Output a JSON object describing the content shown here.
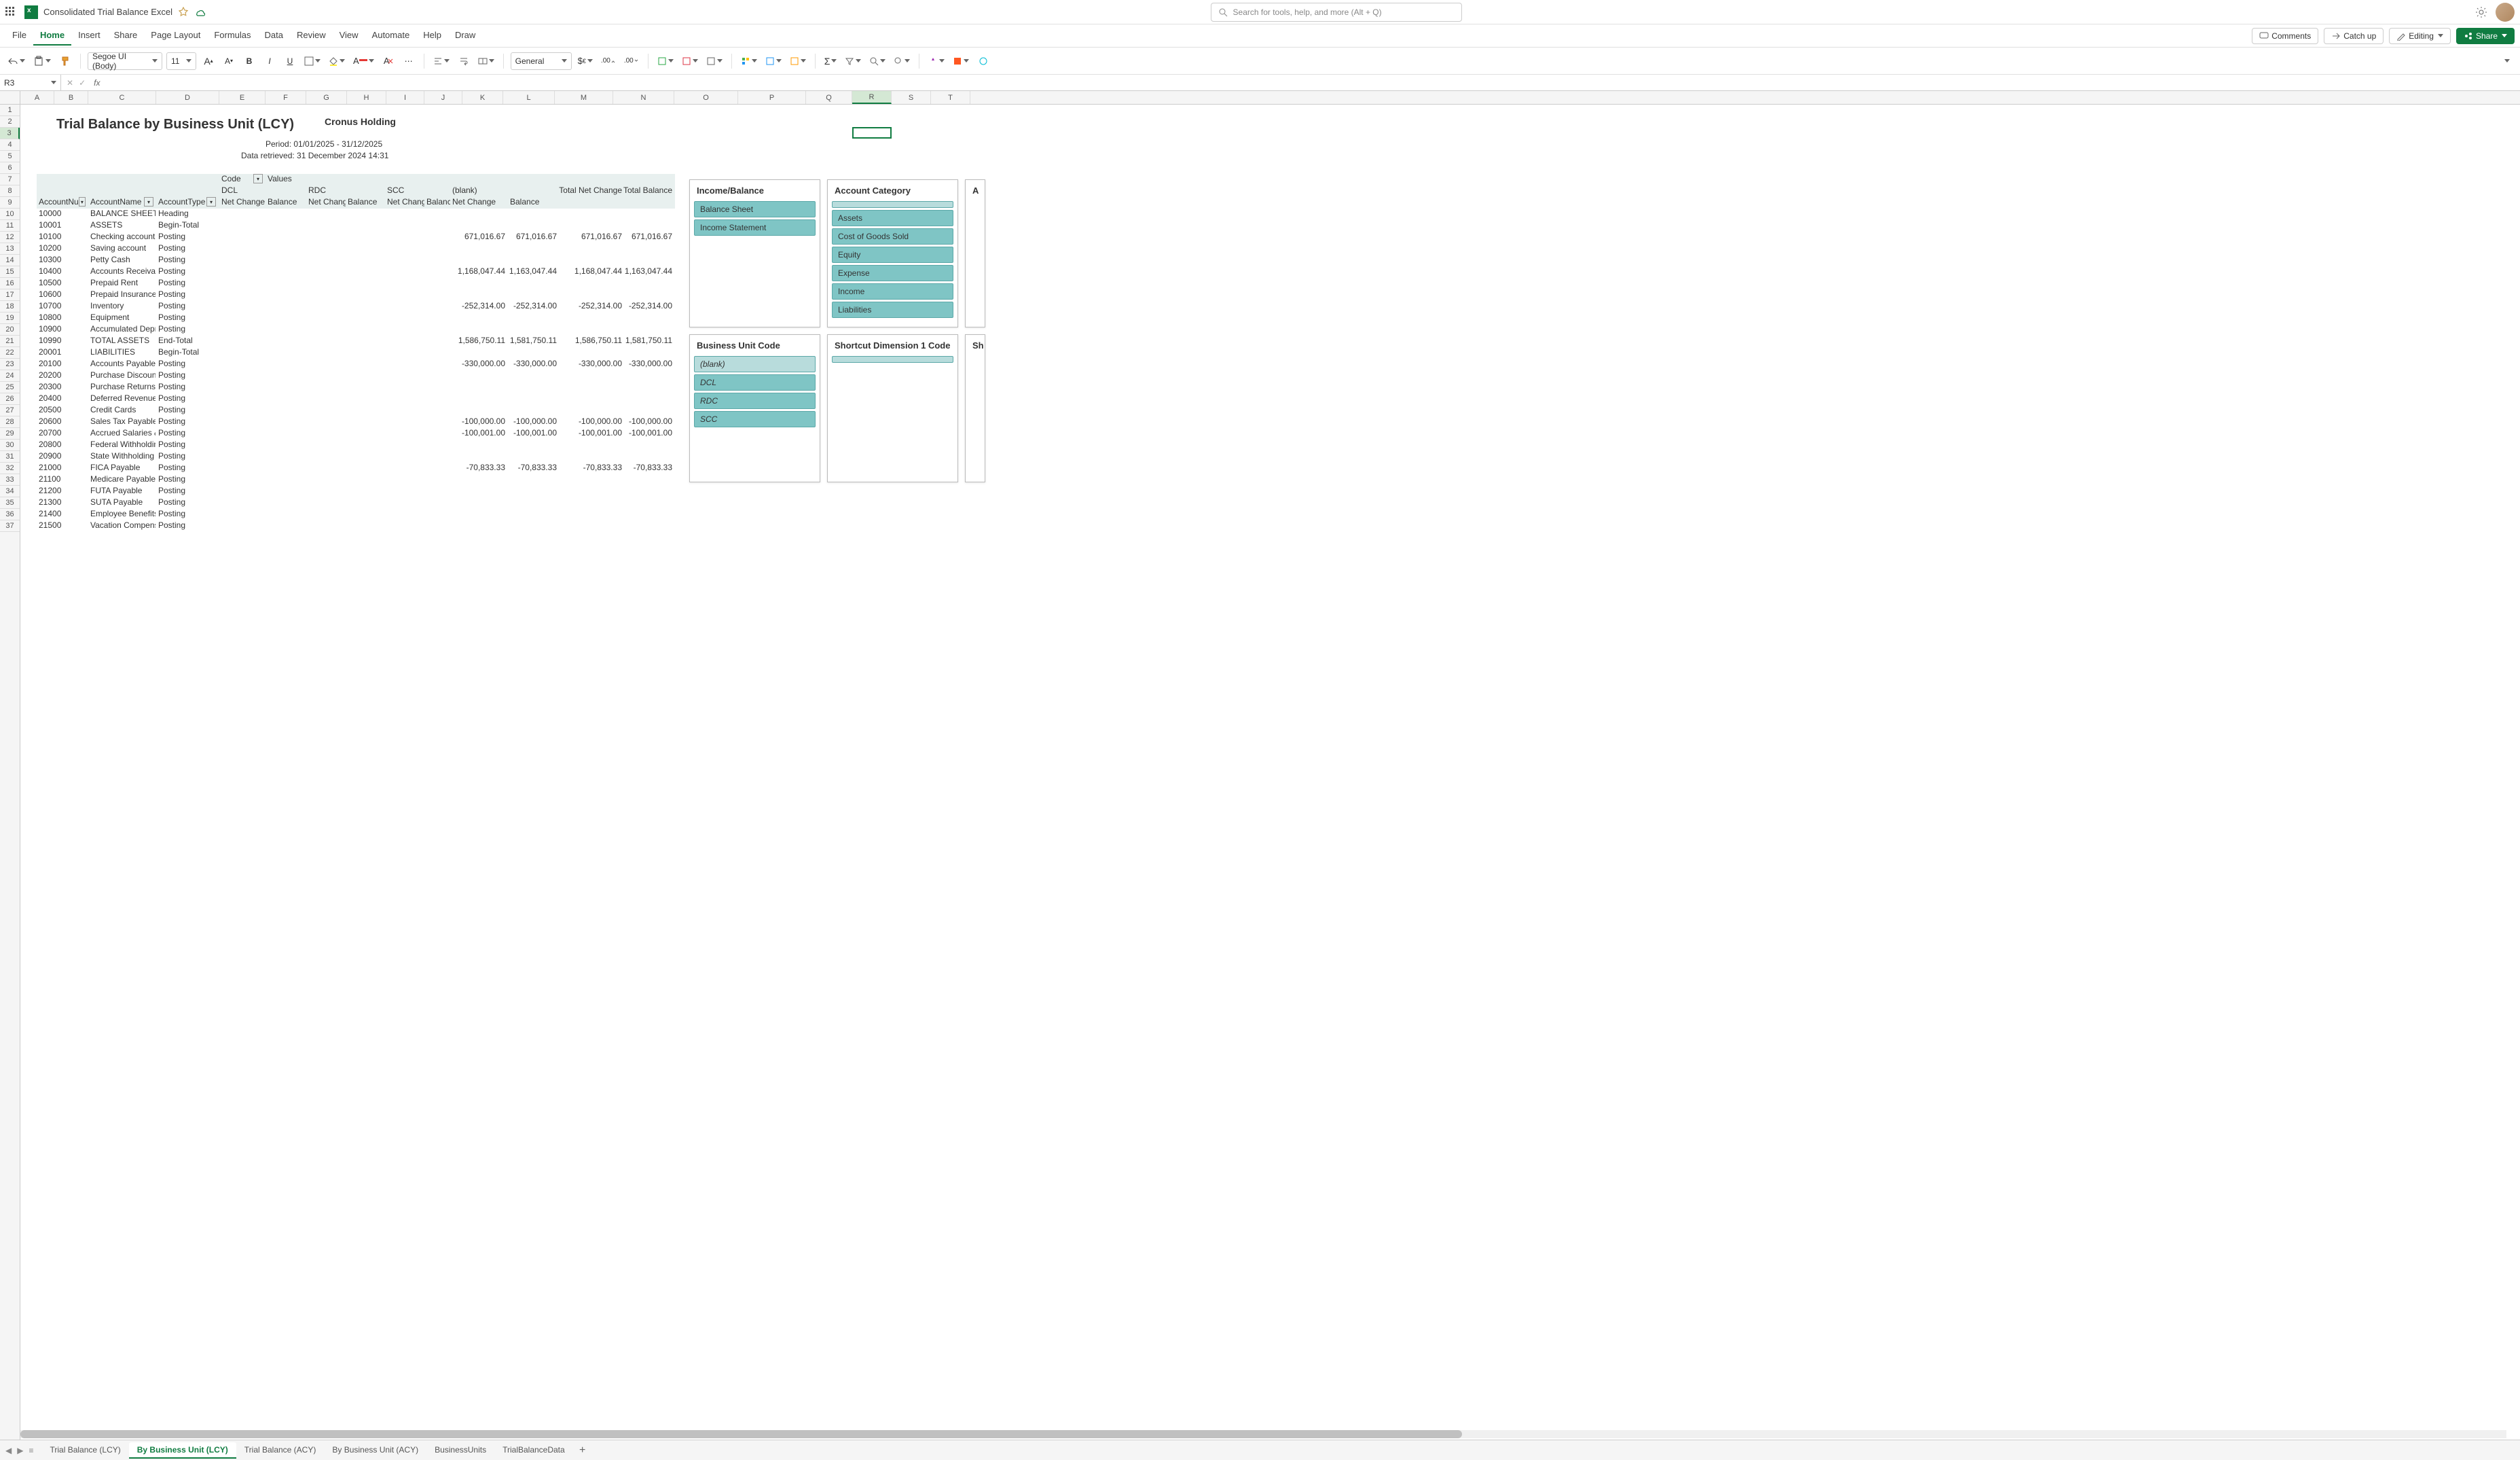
{
  "doc_title": "Consolidated Trial Balance Excel",
  "search_placeholder": "Search for tools, help, and more (Alt + Q)",
  "menu": [
    "File",
    "Home",
    "Insert",
    "Share",
    "Page Layout",
    "Formulas",
    "Data",
    "Review",
    "View",
    "Automate",
    "Help",
    "Draw"
  ],
  "menu_active": "Home",
  "menubar_right": {
    "comments": "Comments",
    "catchup": "Catch up",
    "editing": "Editing",
    "share": "Share"
  },
  "toolbar": {
    "font": "Segoe UI (Body)",
    "size": "11",
    "format": "General"
  },
  "namebox": "R3",
  "columns": [
    {
      "l": "A",
      "w": 50
    },
    {
      "l": "B",
      "w": 50
    },
    {
      "l": "C",
      "w": 100
    },
    {
      "l": "D",
      "w": 93
    },
    {
      "l": "E",
      "w": 68
    },
    {
      "l": "F",
      "w": 60
    },
    {
      "l": "G",
      "w": 60
    },
    {
      "l": "H",
      "w": 58
    },
    {
      "l": "I",
      "w": 56
    },
    {
      "l": "J",
      "w": 56
    },
    {
      "l": "K",
      "w": 60
    },
    {
      "l": "L",
      "w": 76
    },
    {
      "l": "M",
      "w": 86
    },
    {
      "l": "N",
      "w": 90
    },
    {
      "l": "O",
      "w": 94
    },
    {
      "l": "P",
      "w": 100
    },
    {
      "l": "Q",
      "w": 68
    },
    {
      "l": "R",
      "w": 58
    },
    {
      "l": "S",
      "w": 58
    },
    {
      "l": "T",
      "w": 58
    }
  ],
  "report": {
    "title": "Trial Balance by Business Unit (LCY)",
    "company": "Cronus Holding",
    "period": "Period: 01/01/2025 - 31/12/2025",
    "retrieved": "Data retrieved: 31 December 2024 14:31"
  },
  "pivotcols": {
    "code_label": "Code",
    "values_label": "Values",
    "groups": [
      "DCL",
      "RDC",
      "SCC",
      "(blank)"
    ],
    "subcols": [
      "Net Change",
      "Balance"
    ],
    "rowhdrs": [
      "AccountNu",
      "AccountName",
      "AccountType"
    ],
    "totals": [
      "Total Net Change",
      "Total Balance"
    ]
  },
  "rows": [
    {
      "n": "10000",
      "name": "BALANCE SHEET",
      "type": "Heading"
    },
    {
      "n": "10001",
      "name": "ASSETS",
      "type": "Begin-Total"
    },
    {
      "n": "10100",
      "name": "Checking account",
      "type": "Posting",
      "knc": "671,016.67",
      "kbal": "671,016.67",
      "tnc": "671,016.67",
      "tbal": "671,016.67"
    },
    {
      "n": "10200",
      "name": "Saving account",
      "type": "Posting"
    },
    {
      "n": "10300",
      "name": "Petty Cash",
      "type": "Posting"
    },
    {
      "n": "10400",
      "name": "Accounts Receivabl",
      "type": "Posting",
      "knc": "1,168,047.44",
      "kbal": "1,163,047.44",
      "tnc": "1,168,047.44",
      "tbal": "1,163,047.44"
    },
    {
      "n": "10500",
      "name": "Prepaid Rent",
      "type": "Posting"
    },
    {
      "n": "10600",
      "name": "Prepaid Insurance",
      "type": "Posting"
    },
    {
      "n": "10700",
      "name": "Inventory",
      "type": "Posting",
      "knc": "-252,314.00",
      "kbal": "-252,314.00",
      "tnc": "-252,314.00",
      "tbal": "-252,314.00"
    },
    {
      "n": "10800",
      "name": "Equipment",
      "type": "Posting"
    },
    {
      "n": "10900",
      "name": "Accumulated Depre",
      "type": "Posting"
    },
    {
      "n": "10990",
      "name": "TOTAL ASSETS",
      "type": "End-Total",
      "knc": "1,586,750.11",
      "kbal": "1,581,750.11",
      "tnc": "1,586,750.11",
      "tbal": "1,581,750.11"
    },
    {
      "n": "20001",
      "name": "LIABILITIES",
      "type": "Begin-Total"
    },
    {
      "n": "20100",
      "name": "Accounts Payable",
      "type": "Posting",
      "knc": "-330,000.00",
      "kbal": "-330,000.00",
      "tnc": "-330,000.00",
      "tbal": "-330,000.00"
    },
    {
      "n": "20200",
      "name": "Purchase Discounts",
      "type": "Posting"
    },
    {
      "n": "20300",
      "name": "Purchase Returns &",
      "type": "Posting"
    },
    {
      "n": "20400",
      "name": "Deferred Revenue",
      "type": "Posting"
    },
    {
      "n": "20500",
      "name": "Credit Cards",
      "type": "Posting"
    },
    {
      "n": "20600",
      "name": "Sales Tax Payable",
      "type": "Posting",
      "knc": "-100,000.00",
      "kbal": "-100,000.00",
      "tnc": "-100,000.00",
      "tbal": "-100,000.00"
    },
    {
      "n": "20700",
      "name": "Accrued Salaries &",
      "type": "Posting",
      "knc": "-100,001.00",
      "kbal": "-100,001.00",
      "tnc": "-100,001.00",
      "tbal": "-100,001.00"
    },
    {
      "n": "20800",
      "name": "Federal Withholdin",
      "type": "Posting"
    },
    {
      "n": "20900",
      "name": "State Withholding F",
      "type": "Posting"
    },
    {
      "n": "21000",
      "name": "FICA Payable",
      "type": "Posting",
      "knc": "-70,833.33",
      "kbal": "-70,833.33",
      "tnc": "-70,833.33",
      "tbal": "-70,833.33"
    },
    {
      "n": "21100",
      "name": "Medicare Payable",
      "type": "Posting"
    },
    {
      "n": "21200",
      "name": "FUTA Payable",
      "type": "Posting"
    },
    {
      "n": "21300",
      "name": "SUTA Payable",
      "type": "Posting"
    },
    {
      "n": "21400",
      "name": "Employee Benefits F",
      "type": "Posting"
    },
    {
      "n": "21500",
      "name": "Vacation Compensa",
      "type": "Posting"
    }
  ],
  "slicers": {
    "income_balance": {
      "title": "Income/Balance",
      "items": [
        "Balance Sheet",
        "Income Statement"
      ]
    },
    "account_category": {
      "title": "Account Category",
      "items": [
        "",
        "Assets",
        "Cost of Goods Sold",
        "Equity",
        "Expense",
        "Income",
        "Liabilities"
      ]
    },
    "business_unit": {
      "title": "Business Unit Code",
      "items": [
        "(blank)",
        "DCL",
        "RDC",
        "SCC"
      ]
    },
    "dimension1": {
      "title": "Shortcut Dimension 1 Code",
      "items": [
        ""
      ]
    },
    "partial1": {
      "title": "A"
    },
    "partial2": {
      "title": "Sh"
    }
  },
  "sheets": [
    "Trial Balance (LCY)",
    "By Business Unit (LCY)",
    "Trial Balance (ACY)",
    "By Business Unit (ACY)",
    "BusinessUnits",
    "TrialBalanceData"
  ],
  "sheet_active": "By Business Unit (LCY)"
}
